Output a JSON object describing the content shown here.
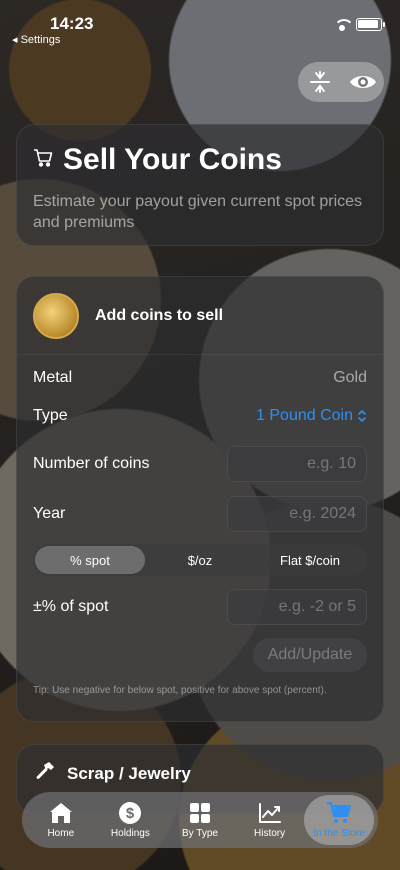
{
  "status": {
    "time": "14:23",
    "back_label": "◂ Settings"
  },
  "header": {
    "title": "Sell Your Coins",
    "subtitle": "Estimate your payout given current spot prices and premiums"
  },
  "form": {
    "header_label": "Add coins to sell",
    "metal_label": "Metal",
    "metal_value": "Gold",
    "type_label": "Type",
    "type_value": "1 Pound Coin",
    "count_label": "Number of coins",
    "count_placeholder": "e.g. 10",
    "year_label": "Year",
    "year_placeholder": "e.g. 2024",
    "segments": [
      "% spot",
      "$/oz",
      "Flat $/coin"
    ],
    "selected_segment": "% spot",
    "spot_label": "±% of spot",
    "spot_placeholder": "e.g. -2 or 5",
    "add_button": "Add/Update",
    "tip": "Tip: Use negative for below spot, positive for above spot (percent)."
  },
  "scrap": {
    "label": "Scrap / Jewelry"
  },
  "tabs": [
    {
      "label": "Home",
      "icon": "house-icon"
    },
    {
      "label": "Holdings",
      "icon": "dollar-circle-icon"
    },
    {
      "label": "By Type",
      "icon": "grid-icon"
    },
    {
      "label": "History",
      "icon": "chart-icon"
    },
    {
      "label": "In the Store",
      "icon": "cart-icon"
    }
  ],
  "colors": {
    "accent": "#2f8ff0"
  }
}
